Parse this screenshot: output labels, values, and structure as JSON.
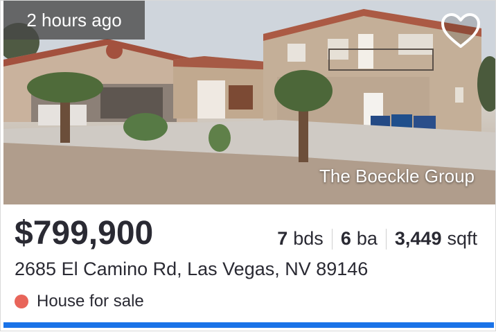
{
  "listing": {
    "time_ago": "2 hours ago",
    "price": "$799,900",
    "beds": "7",
    "beds_unit": "bds",
    "baths": "6",
    "baths_unit": "ba",
    "sqft": "3,449",
    "sqft_unit": "sqft",
    "address": "2685 El Camino Rd, Las Vegas, NV 89146",
    "status": "House for sale",
    "watermark": "The Boeckle Group"
  },
  "icons": {
    "favorite": "heart-outline-icon",
    "status_dot": "circle-dot-icon"
  },
  "colors": {
    "text": "#2a2a33",
    "status_dot": "#e8655a",
    "accent_bar": "#1a73e8"
  }
}
